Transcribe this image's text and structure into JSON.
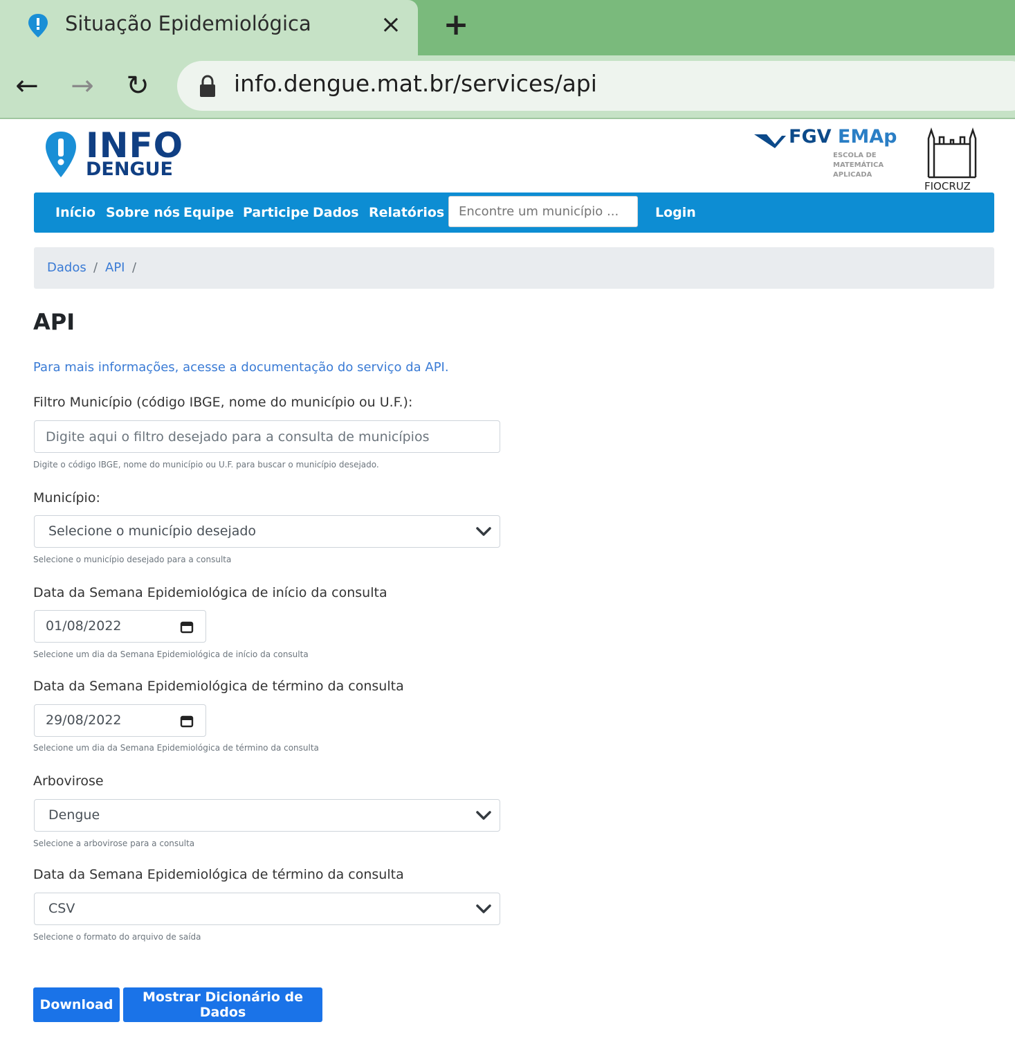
{
  "browser": {
    "tab_title": "Situação Epidemiológica",
    "close_glyph": "×",
    "new_tab_glyph": "+",
    "back_glyph": "←",
    "forward_glyph": "→",
    "reload_glyph": "↻",
    "url": "info.dengue.mat.br/services/api"
  },
  "brand": {
    "logo_line1": "INFO",
    "logo_line2": "DENGUE",
    "fgv": "FGV",
    "emap": "EMAp",
    "emap_sub": [
      "ESCOLA DE",
      "MATEMÁTICA",
      "APLICADA"
    ],
    "fiocruz": "FIOCRUZ",
    "accent": "#0d8dd3",
    "logo_color": "#103f83"
  },
  "nav": {
    "links": [
      "Início",
      "Sobre nós",
      "Equipe",
      "Participe",
      "Dados",
      "Relatórios"
    ],
    "search_placeholder": "Encontre um município ...",
    "login": "Login"
  },
  "breadcrumb": {
    "items": [
      "Dados",
      "API"
    ],
    "separator": "/"
  },
  "page": {
    "title": "API",
    "doc_link": "Para mais informações, acesse a documentação do serviço da API.",
    "filter": {
      "label": "Filtro Município (código IBGE, nome do município ou U.F.):",
      "placeholder": "Digite aqui o filtro desejado para a consulta de municípios",
      "value": "",
      "help": "Digite o código IBGE, nome do município ou U.F. para buscar o município desejado."
    },
    "municipio": {
      "label": "Município:",
      "selected": "Selecione o município desejado",
      "help": "Selecione o município desejado para a consulta"
    },
    "start_date": {
      "label": "Data da Semana Epidemiológica de início da consulta",
      "value": "01/08/2022",
      "help": "Selecione um dia da Semana Epidemiológica de início da consulta"
    },
    "end_date": {
      "label": "Data da Semana Epidemiológica de término da consulta",
      "value": "29/08/2022",
      "help": "Selecione um dia da Semana Epidemiológica de término da consulta"
    },
    "arbovirose": {
      "label": "Arbovirose",
      "selected": "Dengue",
      "help": "Selecione a arbovirose para a consulta"
    },
    "format": {
      "label": "Data da Semana Epidemiológica de término da consulta",
      "selected": "CSV",
      "help": "Selecione o formato do arquivo de saída"
    },
    "buttons": {
      "download": "Download",
      "dictionary": "Mostrar Dicionário de Dados"
    }
  }
}
